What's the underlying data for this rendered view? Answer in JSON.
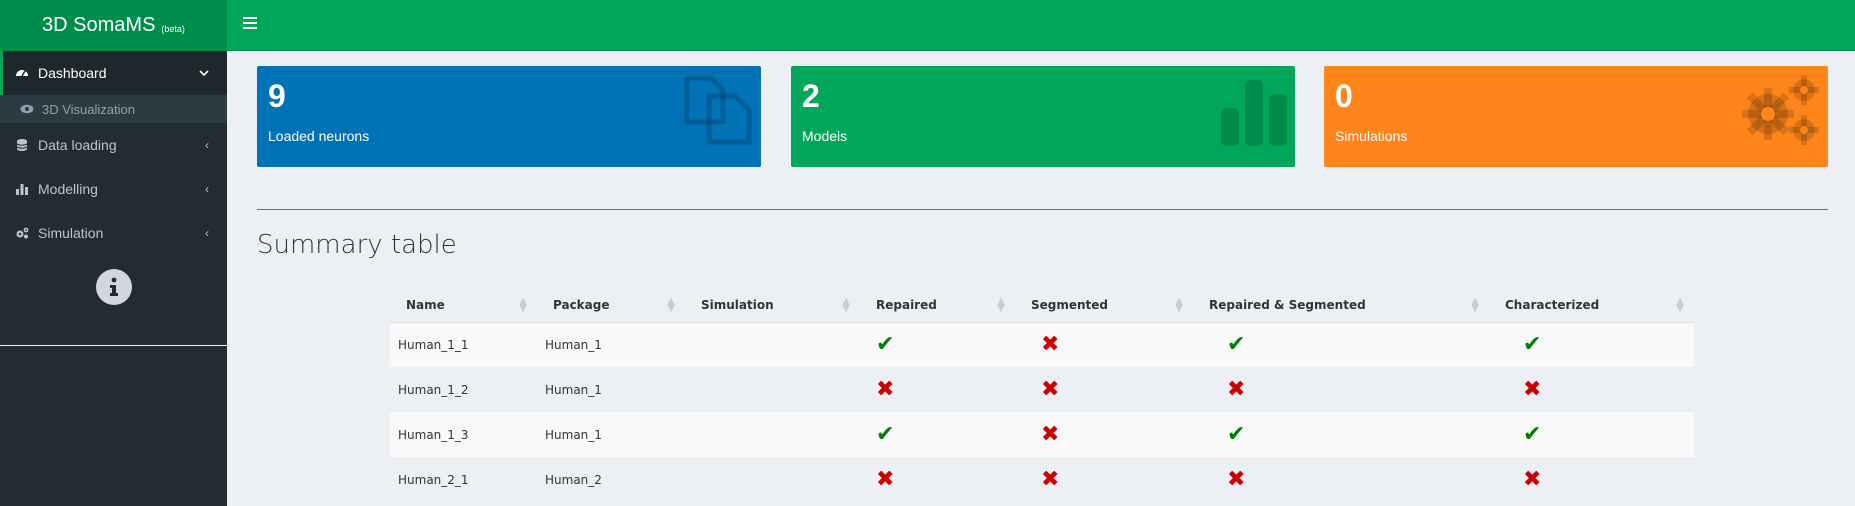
{
  "app": {
    "name": "3D SomaMS",
    "tag": "(beta)"
  },
  "sidebar": {
    "items": [
      {
        "label": "Dashboard",
        "icon": "dashboard-icon",
        "arrow": "⌄"
      },
      {
        "label": "3D Visualization",
        "icon": "eye-icon"
      },
      {
        "label": "Data loading",
        "icon": "database-icon",
        "arrow": "‹"
      },
      {
        "label": "Modelling",
        "icon": "bar-chart-icon",
        "arrow": "‹"
      },
      {
        "label": "Simulation",
        "icon": "cogs-icon",
        "arrow": "‹"
      }
    ]
  },
  "boxes": [
    {
      "value": "9",
      "label": "Loaded neurons",
      "icon": "files-icon",
      "color": "#0073b7"
    },
    {
      "value": "2",
      "label": "Models",
      "icon": "bar-chart-icon",
      "color": "#00a65a"
    },
    {
      "value": "0",
      "label": "Simulations",
      "icon": "cogs-icon",
      "color": "#ff851b"
    }
  ],
  "summary": {
    "title": "Summary table",
    "columns": [
      "Name",
      "Package",
      "Simulation",
      "Repaired",
      "Segmented",
      "Repaired & Segmented",
      "Characterized"
    ],
    "rows": [
      {
        "name": "Human_1_1",
        "package": "Human_1",
        "simulation": "",
        "repaired": true,
        "segmented": false,
        "repaired_segmented": true,
        "characterized": true
      },
      {
        "name": "Human_1_2",
        "package": "Human_1",
        "simulation": "",
        "repaired": false,
        "segmented": false,
        "repaired_segmented": false,
        "characterized": false
      },
      {
        "name": "Human_1_3",
        "package": "Human_1",
        "simulation": "",
        "repaired": true,
        "segmented": false,
        "repaired_segmented": true,
        "characterized": true
      },
      {
        "name": "Human_2_1",
        "package": "Human_2",
        "simulation": "",
        "repaired": false,
        "segmented": false,
        "repaired_segmented": false,
        "characterized": false
      }
    ]
  },
  "marks": {
    "yes": "✔",
    "no": "✖"
  },
  "colors": {
    "accent": "#00a65a",
    "ok": "#008000",
    "error": "#cc0000"
  }
}
